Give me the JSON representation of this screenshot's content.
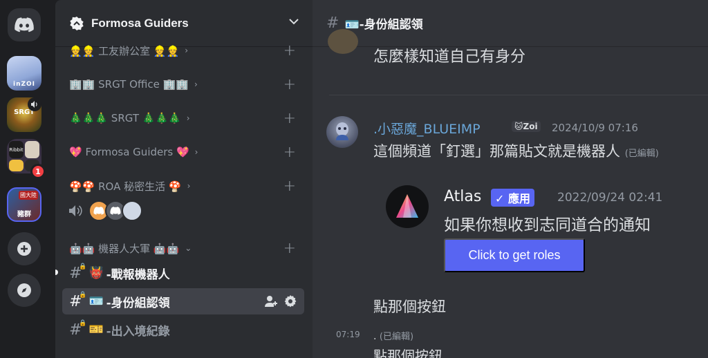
{
  "guild": {
    "name": "Formosa Guiders"
  },
  "servers": [
    {
      "label": "inZOI"
    },
    {
      "label": "SRGT"
    },
    {
      "label": "Ribbit",
      "badge": "1"
    },
    {
      "label": "豬群",
      "tag": "國大陸"
    }
  ],
  "sidebar": {
    "categories": [
      {
        "label": "👷👷 工友辦公室 👷👷"
      },
      {
        "label": "🏢🏢 SRGT Office 🏢🏢"
      },
      {
        "label": "🎄🎄🎄 SRGT 🎄🎄🎄"
      },
      {
        "label": "💖 Formosa Guiders 💖"
      },
      {
        "label": "🍄🍄 ROA 秘密生活 🍄"
      },
      {
        "label": "🤖🤖 機器人大軍 🤖🤖"
      }
    ],
    "channels": [
      {
        "emoji": "👹",
        "label": "-戰報機器人"
      },
      {
        "emoji": "🪪",
        "label": "-身份組認領"
      },
      {
        "emoji": "🎫",
        "label": "-出入境紀錄"
      }
    ]
  },
  "channel_header": {
    "title": "🪪-身份組認領"
  },
  "messages": {
    "top_text": "怎麼樣知道自己有身分",
    "author": ".小惡魔_BLUEIMP",
    "role_tag": "🐱Zoi",
    "timestamp": "2024/10/9 07:16",
    "body": "這個頻道「釘選」那篇貼文就是機器人",
    "edited": "(已編輯)",
    "bot_name": "Atlas",
    "app_tag": "✓ 應用",
    "bot_time": "2022/09/24 02:41",
    "bot_body": "如果你想收到志同道合的通知",
    "button": "Click to get roles",
    "msg2": "點那個按鈕",
    "hover_time": "07:19",
    "msg3": ".",
    "msg3_edited": "(已編輯)",
    "cutoff": "點那個按鈕"
  }
}
